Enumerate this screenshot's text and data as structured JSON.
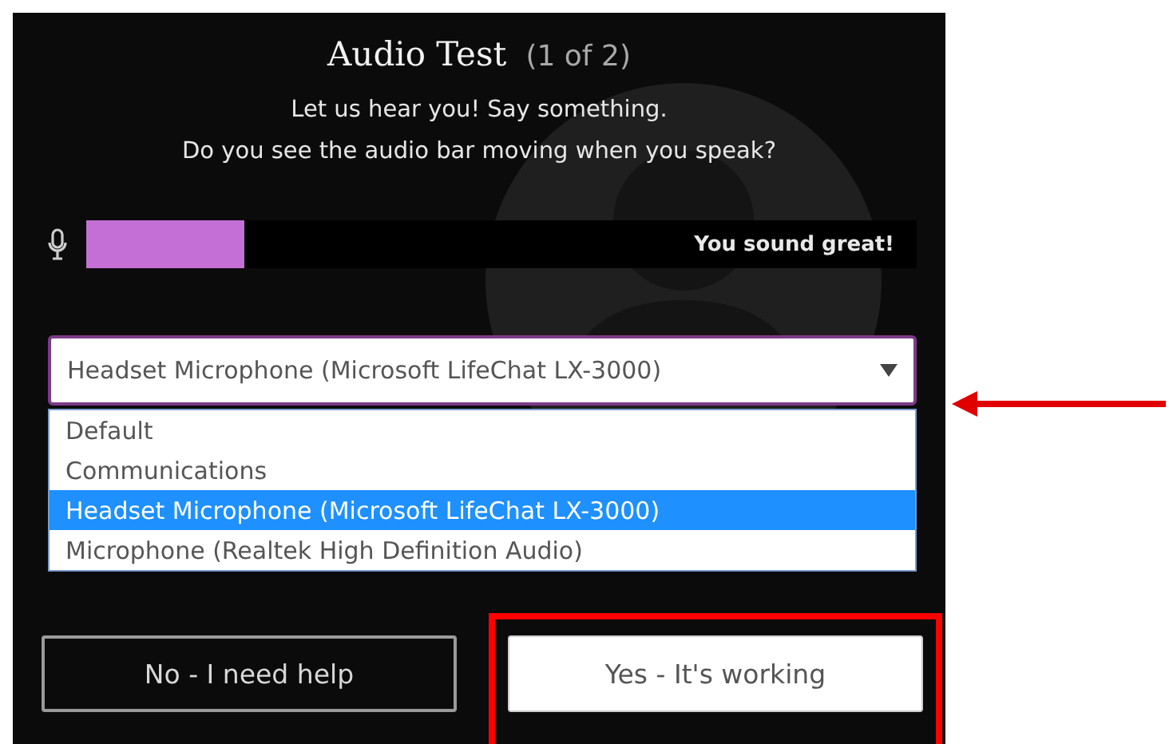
{
  "dialog": {
    "title": "Audio Test",
    "step": "(1 of 2)",
    "instructions": [
      "Let us hear you! Say something.",
      "Do you see the audio bar moving when you speak?"
    ]
  },
  "meter": {
    "level": 0.19,
    "message": "You sound great!"
  },
  "device_select": {
    "value": "Headset Microphone (Microsoft LifeChat LX-3000)",
    "expanded": true,
    "options": [
      {
        "label": "Default",
        "selected": false
      },
      {
        "label": "Communications",
        "selected": false
      },
      {
        "label": "Headset Microphone (Microsoft LifeChat LX-3000)",
        "selected": true
      },
      {
        "label": "Microphone (Realtek High Definition Audio)",
        "selected": false
      }
    ]
  },
  "buttons": [
    {
      "label": "No - I need help",
      "kind": "secondary",
      "highlighted": false
    },
    {
      "label": "Yes - It's working",
      "kind": "primary",
      "highlighted": true
    }
  ]
}
